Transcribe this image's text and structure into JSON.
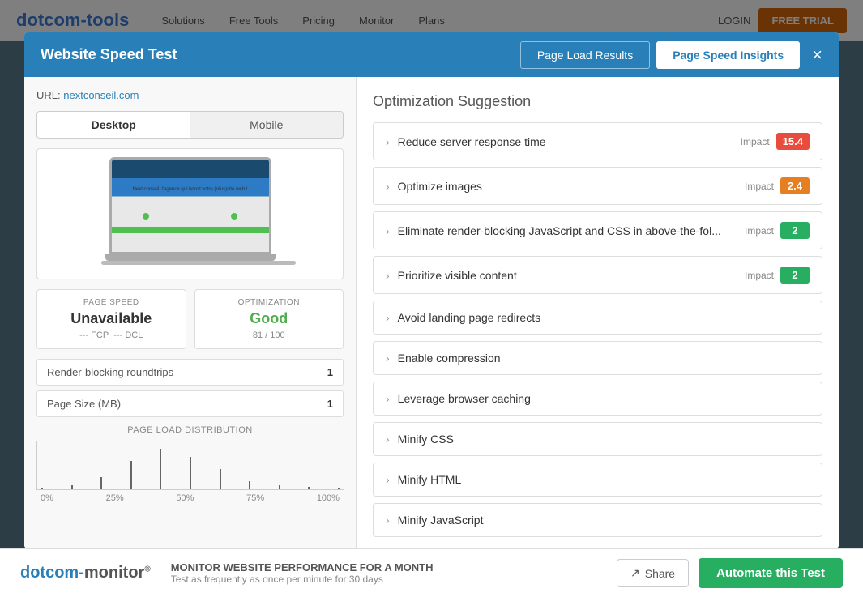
{
  "background": {
    "logo": "dotcom-tools",
    "nav_links": [
      "Solutions",
      "Free Tools",
      "Pricing",
      "Monitor",
      "Plans"
    ],
    "login": "LOGIN",
    "free_trial": "FREE TRIAL"
  },
  "modal": {
    "title": "Website Speed Test",
    "tabs": [
      {
        "label": "Page Load Results",
        "active": false
      },
      {
        "label": "Page Speed Insights",
        "active": true
      }
    ],
    "close_label": "×",
    "url_label": "URL:",
    "url_value": "nextconseil.com",
    "device_tabs": [
      {
        "label": "Desktop",
        "active": true
      },
      {
        "label": "Mobile",
        "active": false
      }
    ],
    "screenshot": {
      "laptop_text": "Next conseil, l'agence\nqui boost votre (réus)site web !"
    },
    "page_speed": {
      "label": "PAGE SPEED",
      "value": "Unavailable",
      "fcp": "--- FCP",
      "dcl": "--- DCL"
    },
    "optimization": {
      "label": "OPTIMIZATION",
      "value": "Good",
      "score": "81 / 100"
    },
    "stats": [
      {
        "label": "Render-blocking roundtrips",
        "value": "1"
      },
      {
        "label": "Page Size (MB)",
        "value": "1"
      }
    ],
    "distribution": {
      "title": "PAGE LOAD DISTRIBUTION",
      "labels": [
        "0%",
        "25%",
        "50%",
        "75%",
        "100%"
      ],
      "bars": [
        2,
        5,
        15,
        35,
        50,
        40,
        25,
        10,
        5,
        3,
        2
      ]
    },
    "optimization_title": "Optimization Suggestion",
    "suggestions": [
      {
        "text": "Reduce server response time",
        "has_impact": true,
        "impact_label": "Impact",
        "impact_value": "15.4",
        "badge_class": "badge-red"
      },
      {
        "text": "Optimize images",
        "has_impact": true,
        "impact_label": "Impact",
        "impact_value": "2.4",
        "badge_class": "badge-orange"
      },
      {
        "text": "Eliminate render-blocking JavaScript and CSS in above-the-fol...",
        "has_impact": true,
        "impact_label": "Impact",
        "impact_value": "2",
        "badge_class": "badge-green"
      },
      {
        "text": "Prioritize visible content",
        "has_impact": true,
        "impact_label": "Impact",
        "impact_value": "2",
        "badge_class": "badge-green"
      },
      {
        "text": "Avoid landing page redirects",
        "has_impact": false
      },
      {
        "text": "Enable compression",
        "has_impact": false
      },
      {
        "text": "Leverage browser caching",
        "has_impact": false
      },
      {
        "text": "Minify CSS",
        "has_impact": false
      },
      {
        "text": "Minify HTML",
        "has_impact": false
      },
      {
        "text": "Minify JavaScript",
        "has_impact": false
      }
    ]
  },
  "footer": {
    "logo_main": "dotcom-monitor",
    "logo_symbol": "®",
    "promo_main": "MONITOR WEBSITE PERFORMANCE FOR A MONTH",
    "promo_sub": "Test as frequently as once per minute for 30 days",
    "share_label": "Share",
    "automate_label": "Automate this Test"
  }
}
